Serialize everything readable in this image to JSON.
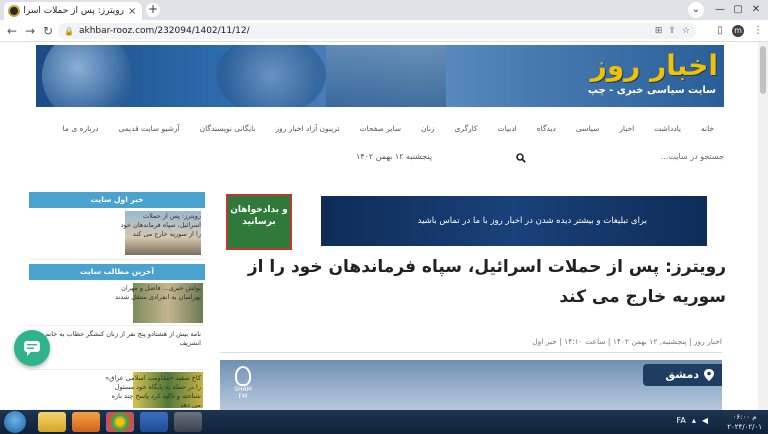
{
  "browser": {
    "tab_title": "رویترز: پس از حملات اسرائیل، سپاه فرم...",
    "tab_close": "×",
    "new_tab": "+",
    "url": "akhbar-rooz.com/232094/1402/11/12/",
    "profile_initial": "m"
  },
  "site": {
    "logo": "اخبار روز",
    "tagline": "سایت سیاسی خبری - چپ",
    "nav": [
      "خانه",
      "یادداشت",
      "اخبار",
      "سیاسی",
      "دیدگاه",
      "ادبیات",
      "کارگری",
      "زنان",
      "سایر صفحات",
      "تریبون آزاد اخبار روز",
      "بایگانی نویسندگان",
      "آرشیو سایت قدیمی",
      "درباره ی ما"
    ],
    "search_placeholder": "جستجو در سایت...",
    "date": "پنجشنبه ۱۲ بهمن ۱۴۰۲"
  },
  "ads": {
    "box_text": "و بدادخواهان برسانید",
    "box_prefix": "و",
    "banner_text": "برای تبلیغات و بیشتر دیده شدن در اخبار روز با ما در تماس باشید"
  },
  "article": {
    "headline": "رویترز: پس از حملات اسرائیل، سپاه فرماندهان خود را از سوریه خارج می کند",
    "meta": "اخبار روز | پنجشنبه, ۱۲ بهمن ۱۴۰۲ | ساعت ۱۴:۱۰ | خبر اول",
    "location_badge": "دمشق",
    "hero_watermark": "SHAM FM"
  },
  "sidebar": {
    "section1_title": "خبر اول سایت",
    "section1_items": [
      {
        "text": "رویترز: پس از حملات اسرائیل، سپاه فرماندهان خود را از سوریه خارج می کند"
      }
    ],
    "section2_title": "آخرین مطالب سایت",
    "section2_items": [
      {
        "text": "پولش خبری... فاضل و مهران بهرامیان به انفرادی منتقل شدند"
      },
      {
        "text": "نامه بیش از هشتادو پنج نفر از زنان کنشگر خطاب به خانم انشریف"
      },
      {
        "text": "کاخ سفید «مقاومت اسلامی عراق» را در حمله به پایگاه خود مسئول شناخته و تاکید کرد پاسخ چند باره می دهد"
      }
    ]
  },
  "taskbar": {
    "time": "۰۶:۰۰ م",
    "date": "۲۰۲۴/۰۲/۰۱",
    "lang": "FA"
  }
}
